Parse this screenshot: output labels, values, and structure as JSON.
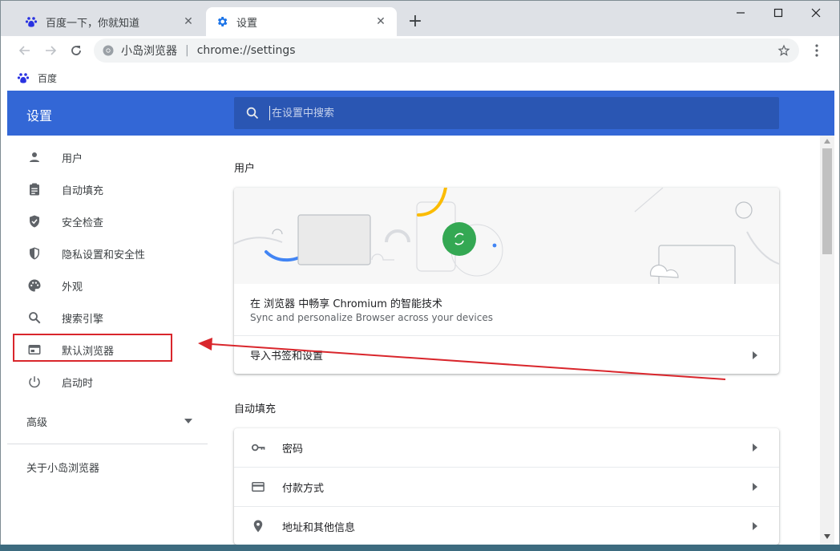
{
  "tabs": [
    {
      "title": "百度一下，你就知道",
      "icon": "baidu-paw-icon"
    },
    {
      "title": "设置",
      "icon": "settings-gear-icon"
    }
  ],
  "toolbar": {
    "site_name": "小岛浏览器",
    "separator": "|",
    "url": "chrome://settings"
  },
  "bookmarks": [
    {
      "label": "百度",
      "icon": "baidu-paw-icon"
    }
  ],
  "settings": {
    "title": "设置",
    "search_placeholder": "在设置中搜索"
  },
  "sidebar": {
    "items": [
      {
        "label": "用户",
        "icon": "person-icon"
      },
      {
        "label": "自动填充",
        "icon": "clipboard-icon"
      },
      {
        "label": "安全检查",
        "icon": "shield-check-icon"
      },
      {
        "label": "隐私设置和安全性",
        "icon": "shield-half-icon"
      },
      {
        "label": "外观",
        "icon": "palette-icon"
      },
      {
        "label": "搜索引擎",
        "icon": "search-icon"
      },
      {
        "label": "默认浏览器",
        "icon": "browser-window-icon"
      },
      {
        "label": "启动时",
        "icon": "power-icon"
      }
    ],
    "advanced": "高级",
    "about": "关于小岛浏览器"
  },
  "main": {
    "users_section": "用户",
    "promo_title": "在 浏览器 中畅享 Chromium 的智能技术",
    "promo_subtitle": "Sync and personalize Browser across your devices",
    "import_row": "导入书签和设置",
    "autofill_section": "自动填充",
    "autofill_rows": [
      {
        "label": "密码",
        "icon": "key-icon"
      },
      {
        "label": "付款方式",
        "icon": "credit-card-icon"
      },
      {
        "label": "地址和其他信息",
        "icon": "location-pin-icon"
      }
    ]
  },
  "colors": {
    "header_blue": "#3367d6",
    "search_blue": "#2a56b3",
    "annotation_red": "#d9262c",
    "sync_green": "#34a853"
  }
}
